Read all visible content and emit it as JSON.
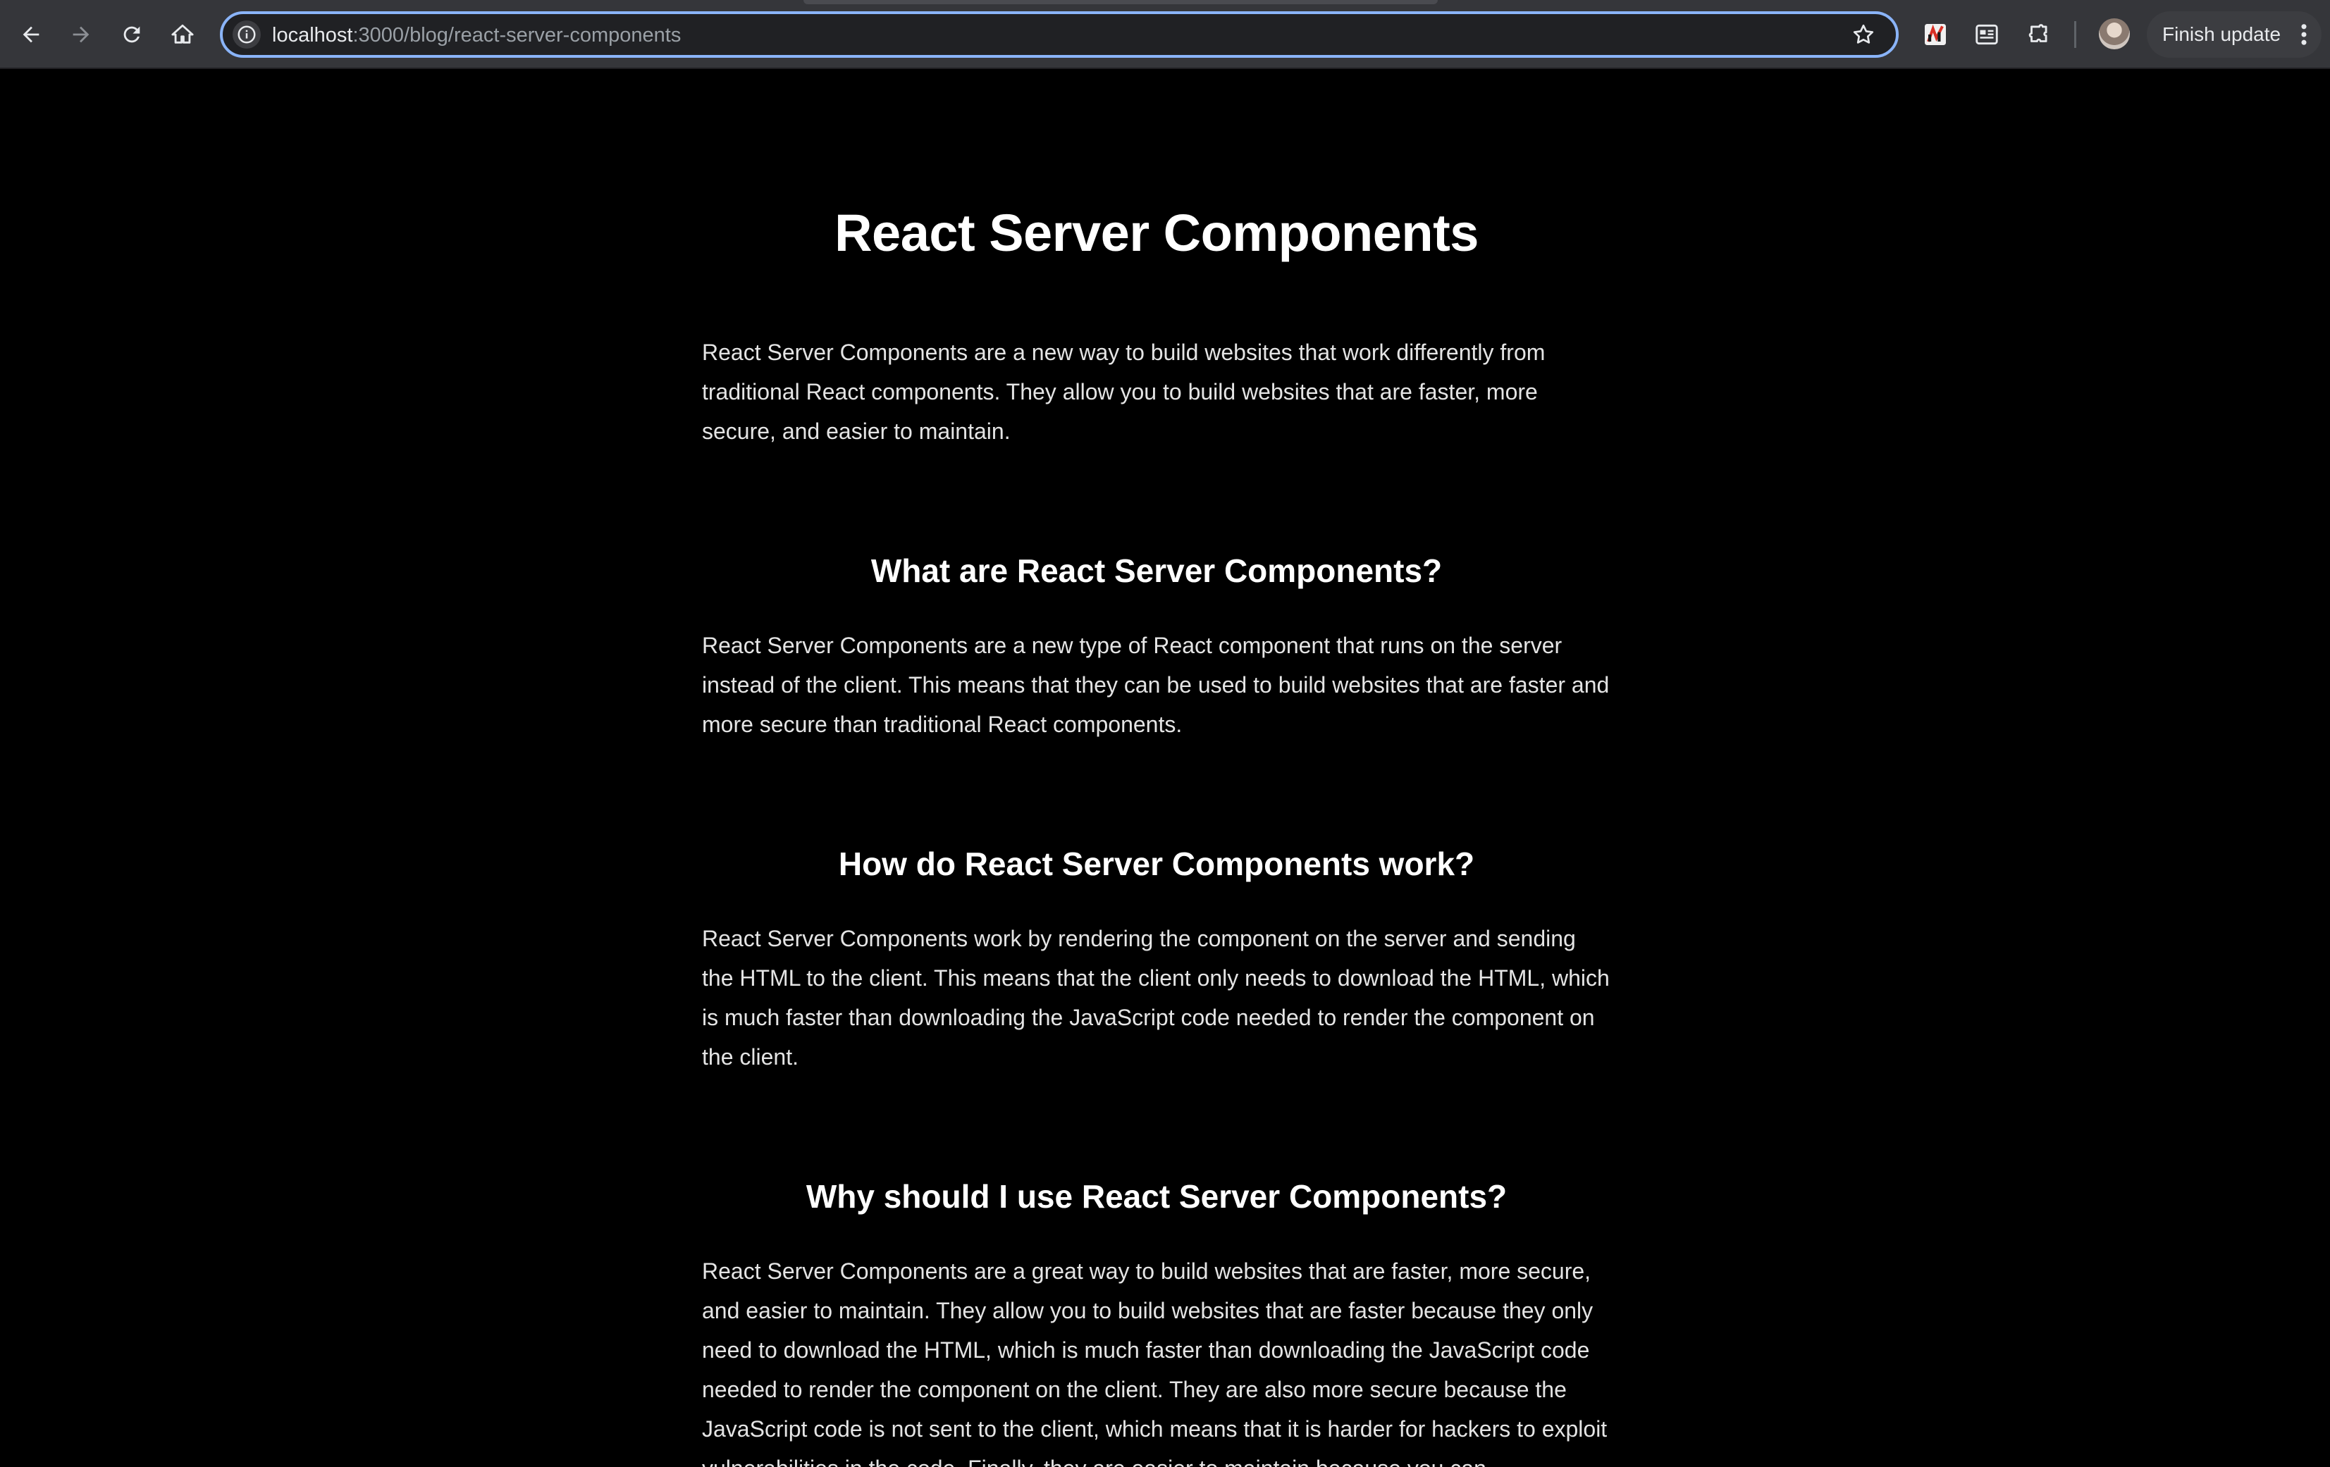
{
  "browser": {
    "url_host": "localhost",
    "url_path": ":3000/blog/react-server-components",
    "finish_update_label": "Finish update"
  },
  "article": {
    "title": "React Server Components",
    "intro": "React Server Components are a new way to build websites that work differently from traditional React components. They allow you to build websites that are faster, more secure, and easier to maintain.",
    "sections": [
      {
        "heading": "What are React Server Components?",
        "body": "React Server Components are a new type of React component that runs on the server instead of the client. This means that they can be used to build websites that are faster and more secure than traditional React components."
      },
      {
        "heading": "How do React Server Components work?",
        "body": "React Server Components work by rendering the component on the server and sending the HTML to the client. This means that the client only needs to download the HTML, which is much faster than downloading the JavaScript code needed to render the component on the client."
      },
      {
        "heading": "Why should I use React Server Components?",
        "body": "React Server Components are a great way to build websites that are faster, more secure, and easier to maintain. They allow you to build websites that are faster because they only need to download the HTML, which is much faster than downloading the JavaScript code needed to render the component on the client. They are also more secure because the JavaScript code is not sent to the client, which means that it is harder for hackers to exploit vulnerabilities in the code. Finally, they are easier to maintain because you can"
      }
    ]
  }
}
